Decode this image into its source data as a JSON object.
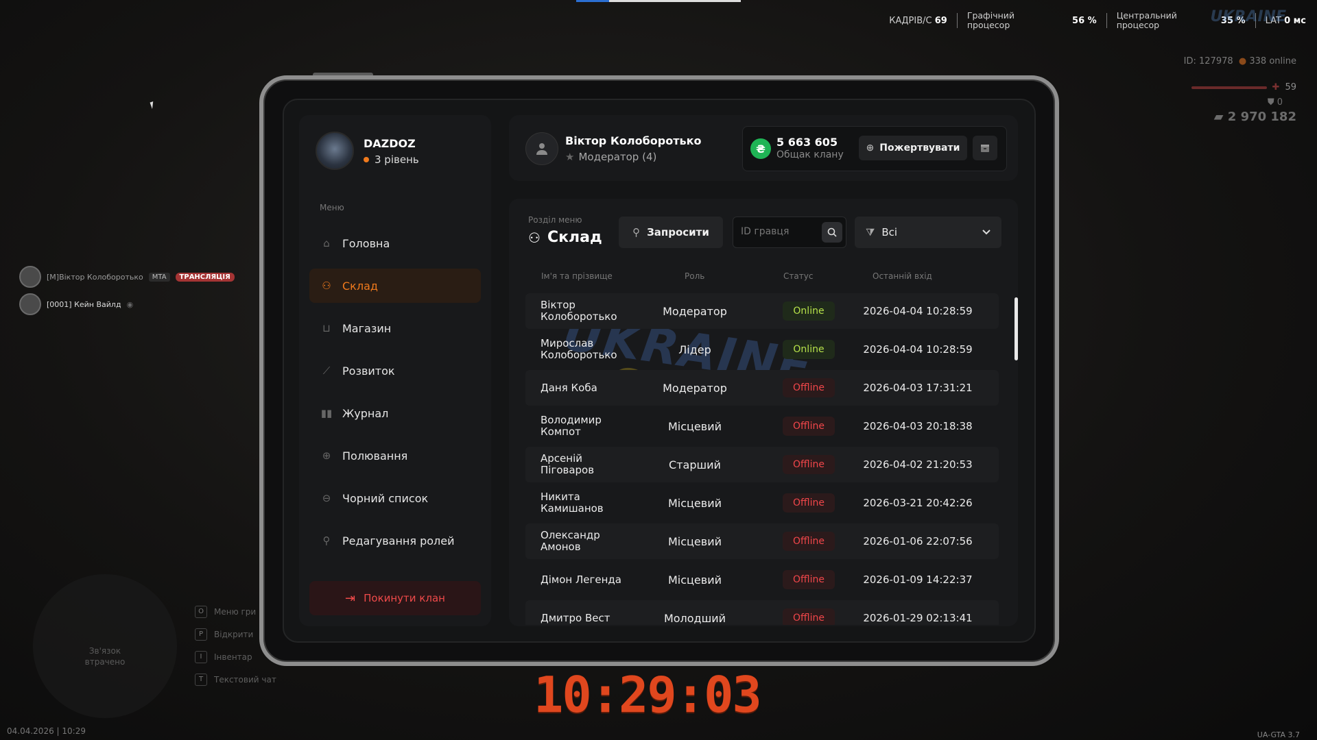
{
  "hud": {
    "fps_label": "КАДРІВ/С",
    "fps_value": "69",
    "gpu_label_1": "Графічний",
    "gpu_label_2": "процесор",
    "gpu_value": "56 %",
    "cpu_label_1": "Центральний",
    "cpu_label_2": "процесор",
    "cpu_value": "35 %",
    "lat_label": "LAT",
    "lat_value": "0 мс",
    "watermark": "UKRAINE",
    "player_id": "ID: 127978",
    "online": "338 online",
    "health": "59",
    "armor": "0",
    "money": "2 970 182",
    "date": "04.04.2026 | 10:29",
    "version": "UA-GTA 3.7",
    "clock": "10:29:03",
    "radar_text_1": "Зв'язок",
    "radar_text_2": "втрачено",
    "chat": [
      {
        "name": "[M]Віктор Колоборотько",
        "tag": "MTA",
        "badge": "ТРАНСЛЯЦІЯ"
      },
      {
        "name": "[0001] Кейн Вайлд"
      }
    ],
    "hints": [
      {
        "key": "O",
        "text": "Меню гри"
      },
      {
        "key": "P",
        "text": "Відкрити"
      },
      {
        "key": "I",
        "text": "Інвентар"
      },
      {
        "key": "T",
        "text": "Текстовий чат"
      }
    ]
  },
  "clan": {
    "name": "DAZDOZ",
    "level": "3 рівень",
    "menu_caption": "Меню",
    "menu": [
      {
        "label": "Головна",
        "icon": "home-icon"
      },
      {
        "label": "Склад",
        "icon": "people-icon",
        "active": true
      },
      {
        "label": "Магазин",
        "icon": "basket-icon"
      },
      {
        "label": "Розвиток",
        "icon": "chart-icon"
      },
      {
        "label": "Журнал",
        "icon": "book-icon"
      },
      {
        "label": "Полювання",
        "icon": "crosshair-icon"
      },
      {
        "label": "Чорний список",
        "icon": "block-icon"
      },
      {
        "label": "Редагування ролей",
        "icon": "user-edit-icon"
      }
    ],
    "leave_label": "Покинути клан"
  },
  "user": {
    "name": "Віктор Колоборотько",
    "role": "Модератор (4)"
  },
  "balance": {
    "value": "5 663 605",
    "label": "Общак клану",
    "currency_symbol": "₴",
    "donate_label": "Пожертвувати"
  },
  "section": {
    "caption": "Розділ меню",
    "title": "Склад",
    "invite_label": "Запросити",
    "search_placeholder": "ID гравця",
    "filter_value": "Всі"
  },
  "table": {
    "headers": [
      "Ім'я та прізвище",
      "Роль",
      "Статус",
      "Останній вхід"
    ],
    "rows": [
      {
        "name": "Віктор Колоборотько",
        "role": "Модератор",
        "status": "Online",
        "last": "2026-04-04 10:28:59"
      },
      {
        "name": "Мирослав Колоборотько",
        "role": "Лідер",
        "status": "Online",
        "last": "2026-04-04 10:28:59"
      },
      {
        "name": "Даня Коба",
        "role": "Модератор",
        "status": "Offline",
        "last": "2026-04-03 17:31:21"
      },
      {
        "name": "Володимир Компот",
        "role": "Місцевий",
        "status": "Offline",
        "last": "2026-04-03 20:18:38"
      },
      {
        "name": "Арсеній Піговаров",
        "role": "Старший",
        "status": "Offline",
        "last": "2026-04-02 21:20:53"
      },
      {
        "name": "Никита Камишанов",
        "role": "Місцевий",
        "status": "Offline",
        "last": "2026-03-21 20:42:26"
      },
      {
        "name": "Олександр Амонов",
        "role": "Місцевий",
        "status": "Offline",
        "last": "2026-01-06 22:07:56"
      },
      {
        "name": "Дімон Легенда",
        "role": "Місцевий",
        "status": "Offline",
        "last": "2026-01-09 14:22:37"
      },
      {
        "name": "Дмитро Вест",
        "role": "Молодший",
        "status": "Offline",
        "last": "2026-01-29 02:13:41"
      }
    ]
  },
  "colors": {
    "accent": "#f07a1d",
    "online": "#b6e14a",
    "offline": "#f0464a",
    "coin": "#1fb455",
    "clock": "#e0471e"
  }
}
